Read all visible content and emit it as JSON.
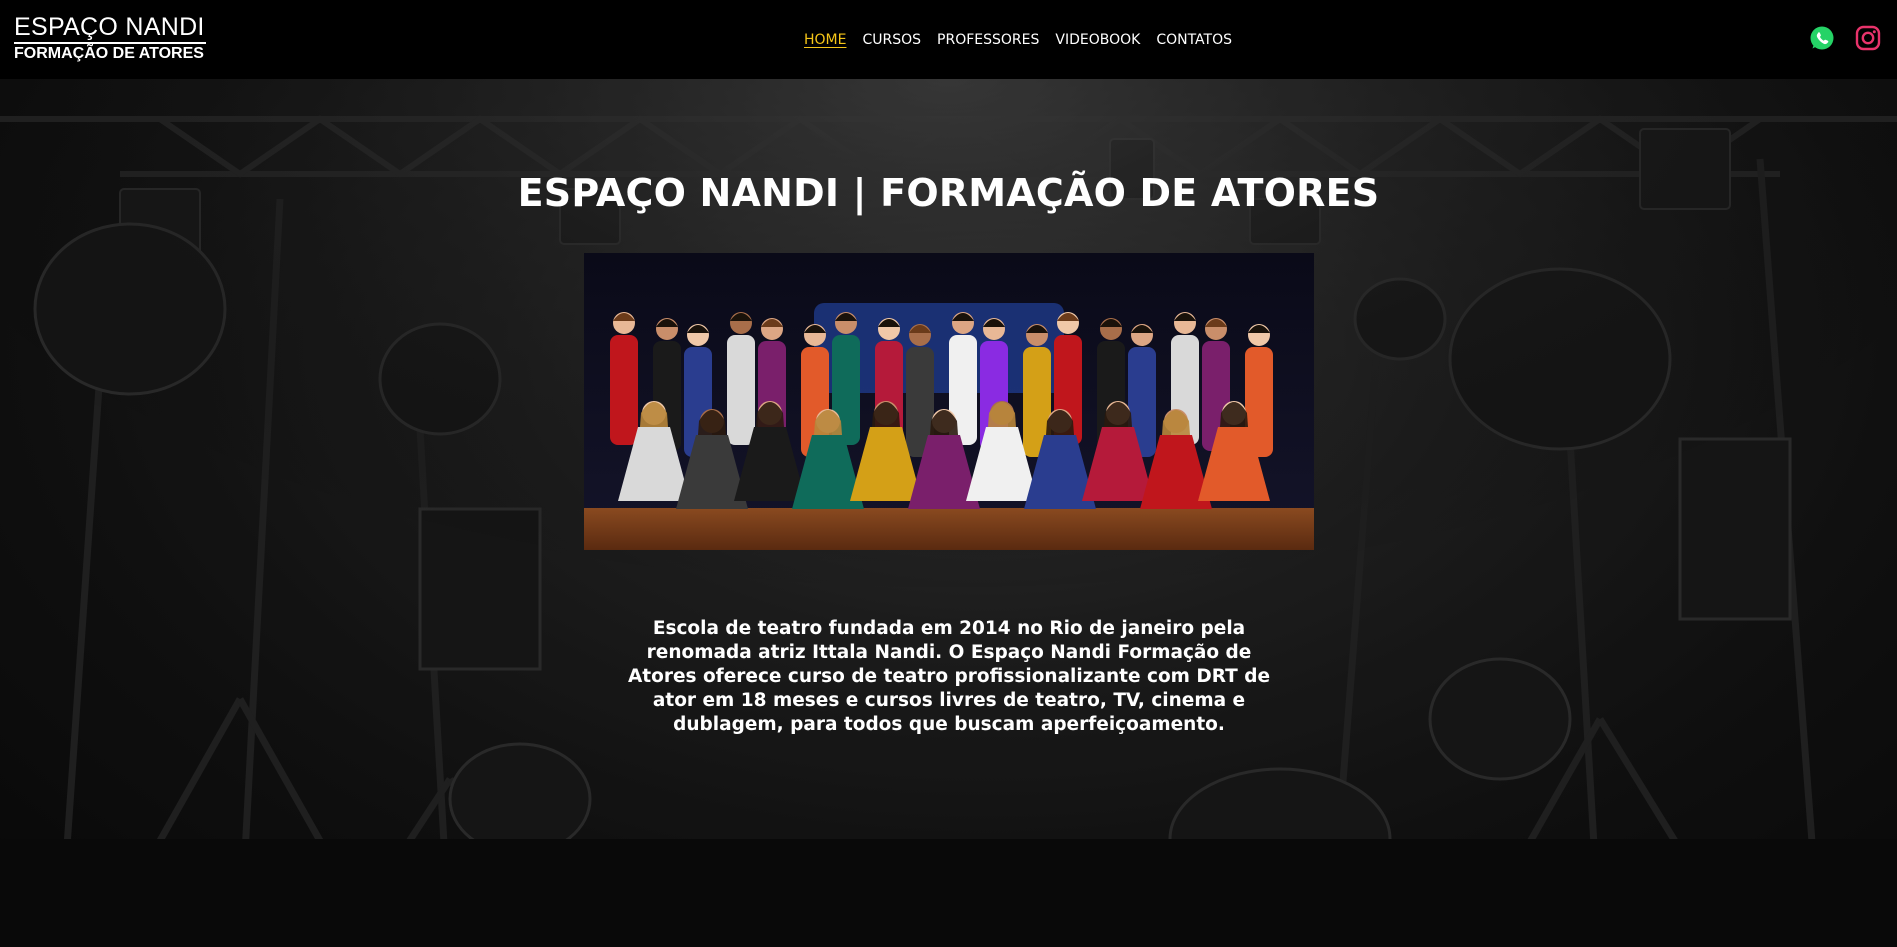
{
  "header": {
    "logo": {
      "line1": "ESPAÇO NANDI",
      "line2": "FORMAÇÃO DE ATORES"
    },
    "nav": [
      {
        "label": "HOME",
        "active": true
      },
      {
        "label": "CURSOS",
        "active": false
      },
      {
        "label": "PROFESSORES",
        "active": false
      },
      {
        "label": "VIDEOBOOK",
        "active": false
      },
      {
        "label": "CONTATOS",
        "active": false
      }
    ],
    "social": {
      "whatsapp_icon": "whatsapp-icon",
      "instagram_icon": "instagram-icon"
    },
    "active_color": "#f5c518"
  },
  "hero": {
    "title": "ESPAÇO NANDI | FORMAÇÃO DE ATORES",
    "photo_icon": "group-photo",
    "description": "Escola de teatro fundada em 2014 no Rio de janeiro pela renomada atriz Ittala Nandi. O Espaço Nandi Formação de Atores oferece curso de teatro profissionalizante com DRT de ator em 18 meses e cursos livres de teatro, TV, cinema e dublagem, para todos que buscam aperfeiçoamento."
  }
}
